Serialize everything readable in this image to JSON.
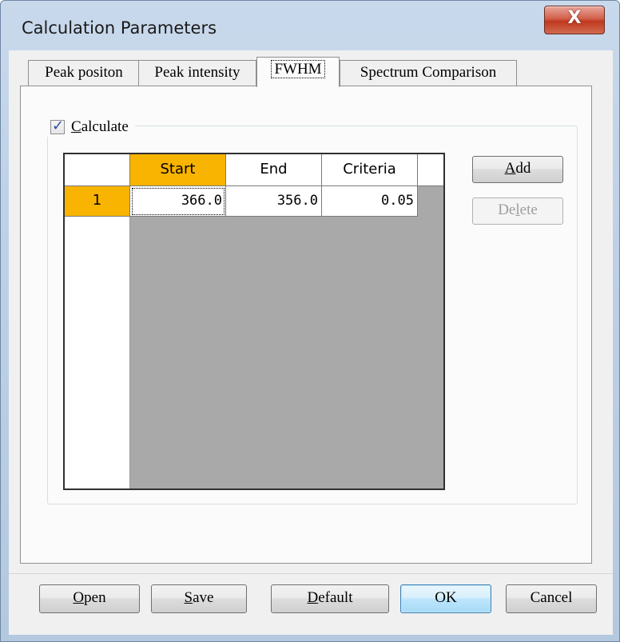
{
  "window": {
    "title": "Calculation Parameters",
    "close_glyph": "X"
  },
  "tabs": [
    {
      "label": "Peak positon",
      "active": false
    },
    {
      "label": "Peak intensity",
      "active": false
    },
    {
      "label": "FWHM",
      "active": true
    },
    {
      "label": "Spectrum Comparison",
      "active": false
    }
  ],
  "calculate": {
    "label": "Calculate",
    "checked": true,
    "check_glyph": "✓"
  },
  "grid": {
    "columns": [
      "Start",
      "End",
      "Criteria"
    ],
    "rows": [
      {
        "index": "1",
        "start": "366.0",
        "end": "356.0",
        "criteria": "0.05"
      }
    ]
  },
  "side_buttons": {
    "add": "Add",
    "delete": "Delete"
  },
  "footer_buttons": {
    "open": "Open",
    "save": "Save",
    "default": "Default",
    "ok": "OK",
    "cancel": "Cancel"
  },
  "colors": {
    "selected_header": "#f8b400",
    "grid_empty": "#a9a9a9",
    "close_button": "#c0391f"
  }
}
